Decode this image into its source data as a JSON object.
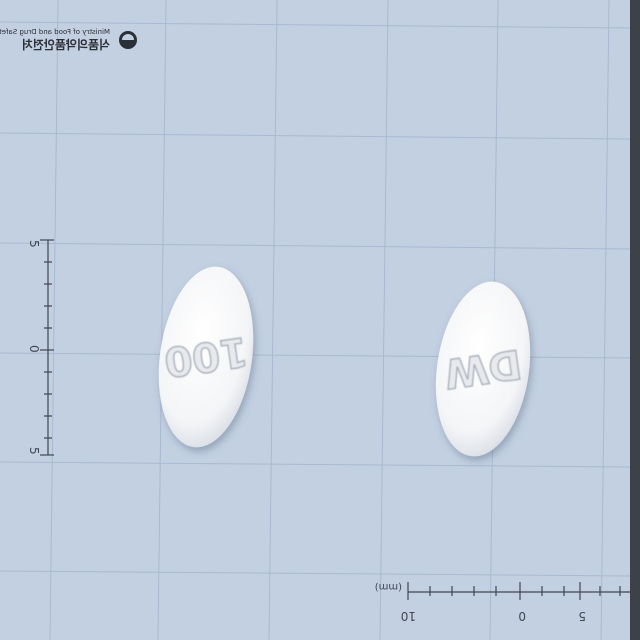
{
  "watermark": {
    "korean": "식품의약품안전처",
    "english": "Ministry of Food and Drug Safety",
    "logo_icon": "ministry-seal-icon"
  },
  "ruler_left": {
    "labels": [
      "5",
      "0",
      "5"
    ]
  },
  "ruler_bottom": {
    "unit": "(mm)",
    "labels": [
      "10",
      "0",
      "5"
    ]
  },
  "pills": [
    {
      "imprint": "100"
    },
    {
      "imprint": "DW"
    }
  ],
  "colors": {
    "background": "#c2d0e2",
    "grid_line": "#9fb0c8",
    "pill": "#f7f7f7",
    "pill_shade": "#d7dbe2",
    "ruler": "#41464f"
  }
}
